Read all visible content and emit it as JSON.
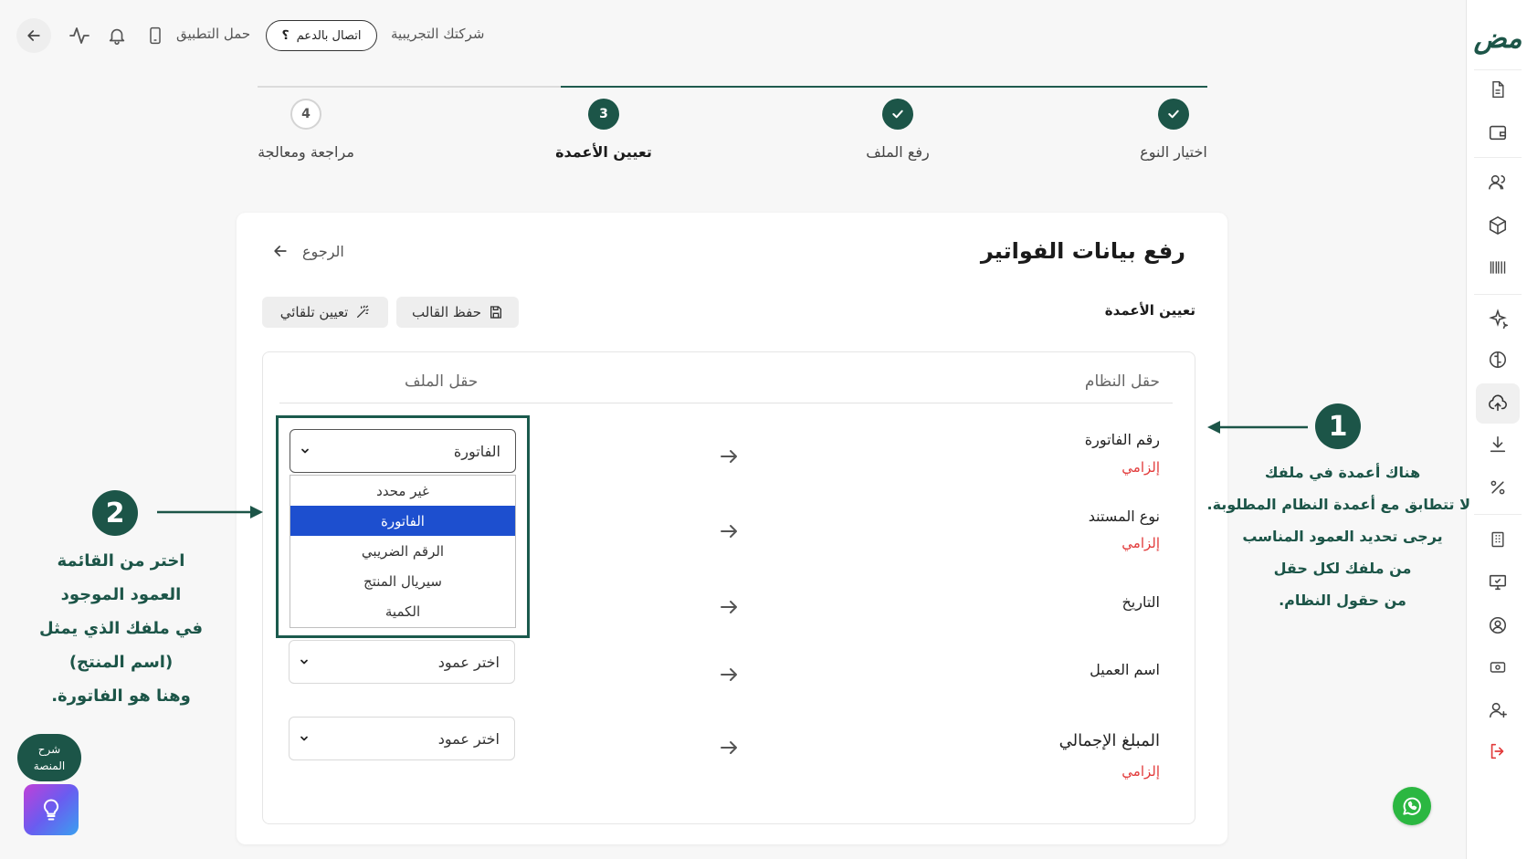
{
  "topbar": {
    "company": "شركتك التجريبية",
    "support_label": "اتصال بالدعم",
    "app_download": "حمل التطبيق"
  },
  "sidebar": {
    "logo_text": "مض",
    "icons": [
      "file-icon",
      "wallet-icon",
      "users-icon",
      "box-icon",
      "barcode-icon",
      "sparkle-icon",
      "brain-icon",
      "upload-cloud-icon",
      "download-icon",
      "percent-icon",
      "building-icon",
      "monitor-icon",
      "user-circle-icon",
      "cash-icon",
      "user-plus-icon",
      "logout-icon"
    ]
  },
  "stepper": {
    "steps": [
      {
        "label": "اختيار النوع",
        "state": "done",
        "number": ""
      },
      {
        "label": "رفع الملف",
        "state": "done",
        "number": ""
      },
      {
        "label": "تعيين الأعمدة",
        "state": "current",
        "number": "3"
      },
      {
        "label": "مراجعة ومعالجة",
        "state": "pending",
        "number": "4"
      }
    ]
  },
  "card": {
    "title": "رفع بيانات الفواتير",
    "back_label": "الرجوع",
    "section_label": "تعيين الأعمدة",
    "save_template": "حفظ القالب",
    "auto_assign": "تعيين تلقائي",
    "headers": {
      "system_field": "حقل النظام",
      "file_field": "حقل الملف"
    },
    "required_label": "إلزامي",
    "rows": [
      {
        "label": "رقم الفاتورة",
        "required": true,
        "value": "الفاتورة"
      },
      {
        "label": "نوع المستند",
        "required": true,
        "value": ""
      },
      {
        "label": "التاريخ",
        "required": false,
        "value": ""
      },
      {
        "label": "اسم العميل",
        "required": false,
        "value": "اختر عمود"
      },
      {
        "label": "المبلغ الإجمالي",
        "required": true,
        "value": "اختر عمود"
      }
    ],
    "dropdown_options": [
      "غير محدد",
      "الفاتورة",
      "الرقم الضريبي",
      "سيريال المنتج",
      "الكمية"
    ],
    "dropdown_selected_index": 1
  },
  "annotations": {
    "one": {
      "number": "1",
      "lines": [
        "هناك أعمدة في ملفك",
        "لا تتطابق مع أعمدة النظام المطلوبة.",
        "يرجى تحديد العمود المناسب",
        "من ملفك لكل حقل",
        "من حقول النظام."
      ]
    },
    "two": {
      "number": "2",
      "lines": [
        "اختر من القائمة",
        "العمود الموجود",
        "في ملفك الذي يمثل",
        "(اسم المنتج)",
        "وهنا هو الفاتورة."
      ]
    }
  },
  "help": {
    "explain_line1": "شرح",
    "explain_line2": "المنصة"
  },
  "colors": {
    "brand": "#1c5548",
    "required": "#e23b3b",
    "selected_option": "#1d4fcf"
  }
}
